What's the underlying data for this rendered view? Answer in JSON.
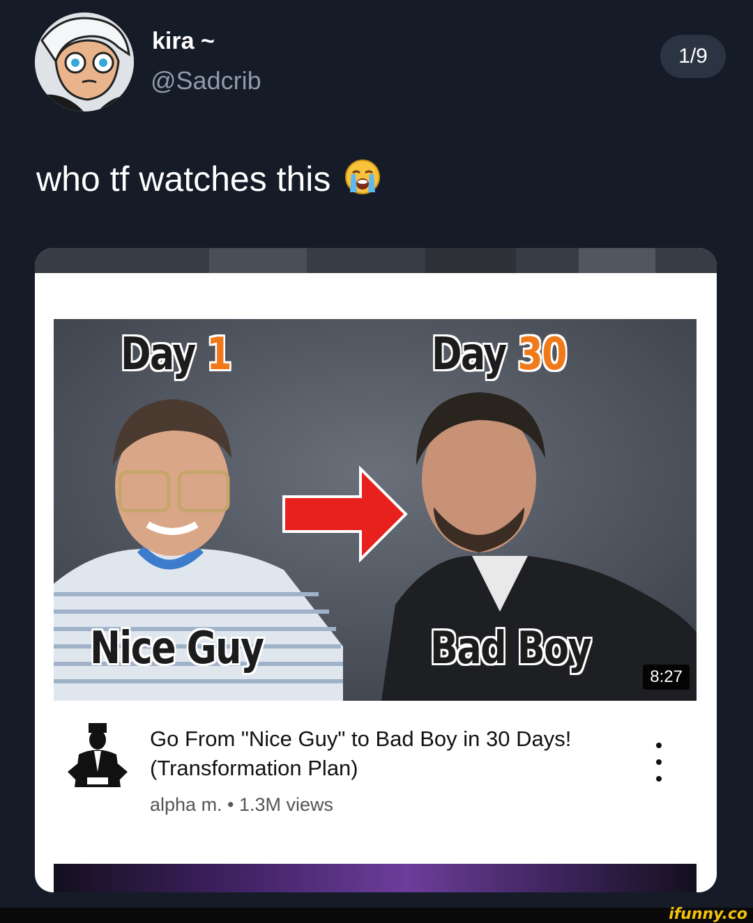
{
  "header": {
    "display_name": "kira ~",
    "handle": "@Sadcrib",
    "image_counter": "1/9"
  },
  "tweet": {
    "text": "who tf watches this",
    "emoji": "loudly-crying-face-icon"
  },
  "video": {
    "thumbnail": {
      "left_label_word": "Day",
      "left_label_num": "1",
      "right_label_word": "Day",
      "right_label_num": "30",
      "left_caption": "Nice Guy",
      "right_caption": "Bad Boy",
      "duration": "8:27"
    },
    "title": "Go From \"Nice Guy\" to Bad Boy in 30 Days! (Transformation Plan)",
    "meta": "alpha m. • 1.3M views"
  },
  "watermark": "ifunny.co",
  "colors": {
    "background": "#151c28",
    "handle": "#8f9aab",
    "accent_number": "#f07a1a",
    "arrow": "#e8211f",
    "watermark": "#f4c20d"
  }
}
